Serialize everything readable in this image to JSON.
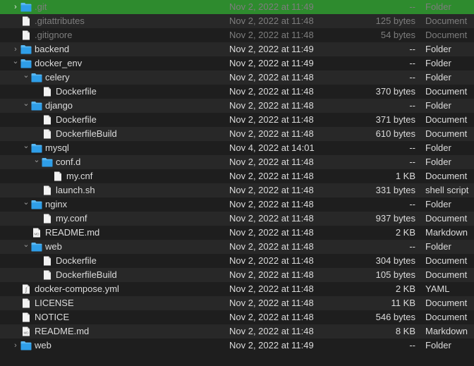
{
  "rows": [
    {
      "name": ".git",
      "date": "Nov 2, 2022 at 11:49",
      "size": "--",
      "kind": "Folder",
      "type": "folder",
      "depth": 0,
      "chevron": "right",
      "selected": true,
      "dim": true
    },
    {
      "name": ".gitattributes",
      "date": "Nov 2, 2022 at 11:48",
      "size": "125 bytes",
      "kind": "Document",
      "type": "file",
      "depth": 0,
      "chevron": "",
      "dim": true
    },
    {
      "name": ".gitignore",
      "date": "Nov 2, 2022 at 11:48",
      "size": "54 bytes",
      "kind": "Document",
      "type": "file",
      "depth": 0,
      "chevron": "",
      "dim": true
    },
    {
      "name": "backend",
      "date": "Nov 2, 2022 at 11:49",
      "size": "--",
      "kind": "Folder",
      "type": "folder",
      "depth": 0,
      "chevron": "right"
    },
    {
      "name": "docker_env",
      "date": "Nov 2, 2022 at 11:49",
      "size": "--",
      "kind": "Folder",
      "type": "folder",
      "depth": 0,
      "chevron": "down"
    },
    {
      "name": "celery",
      "date": "Nov 2, 2022 at 11:48",
      "size": "--",
      "kind": "Folder",
      "type": "folder",
      "depth": 1,
      "chevron": "down"
    },
    {
      "name": "Dockerfile",
      "date": "Nov 2, 2022 at 11:48",
      "size": "370 bytes",
      "kind": "Document",
      "type": "file",
      "depth": 2,
      "chevron": ""
    },
    {
      "name": "django",
      "date": "Nov 2, 2022 at 11:48",
      "size": "--",
      "kind": "Folder",
      "type": "folder",
      "depth": 1,
      "chevron": "down"
    },
    {
      "name": "Dockerfile",
      "date": "Nov 2, 2022 at 11:48",
      "size": "371 bytes",
      "kind": "Document",
      "type": "file",
      "depth": 2,
      "chevron": ""
    },
    {
      "name": "DockerfileBuild",
      "date": "Nov 2, 2022 at 11:48",
      "size": "610 bytes",
      "kind": "Document",
      "type": "file",
      "depth": 2,
      "chevron": ""
    },
    {
      "name": "mysql",
      "date": "Nov 4, 2022 at 14:01",
      "size": "--",
      "kind": "Folder",
      "type": "folder",
      "depth": 1,
      "chevron": "down"
    },
    {
      "name": "conf.d",
      "date": "Nov 2, 2022 at 11:48",
      "size": "--",
      "kind": "Folder",
      "type": "folder",
      "depth": 2,
      "chevron": "down"
    },
    {
      "name": "my.cnf",
      "date": "Nov 2, 2022 at 11:48",
      "size": "1 KB",
      "kind": "Document",
      "type": "file",
      "depth": 3,
      "chevron": ""
    },
    {
      "name": "launch.sh",
      "date": "Nov 2, 2022 at 11:48",
      "size": "331 bytes",
      "kind": "shell script",
      "type": "file",
      "depth": 2,
      "chevron": ""
    },
    {
      "name": "nginx",
      "date": "Nov 2, 2022 at 11:48",
      "size": "--",
      "kind": "Folder",
      "type": "folder",
      "depth": 1,
      "chevron": "down"
    },
    {
      "name": "my.conf",
      "date": "Nov 2, 2022 at 11:48",
      "size": "937 bytes",
      "kind": "Document",
      "type": "file",
      "depth": 2,
      "chevron": ""
    },
    {
      "name": "README.md",
      "date": "Nov 2, 2022 at 11:48",
      "size": "2 KB",
      "kind": "Markdown",
      "type": "md",
      "depth": 1,
      "chevron": ""
    },
    {
      "name": "web",
      "date": "Nov 2, 2022 at 11:48",
      "size": "--",
      "kind": "Folder",
      "type": "folder",
      "depth": 1,
      "chevron": "down"
    },
    {
      "name": "Dockerfile",
      "date": "Nov 2, 2022 at 11:48",
      "size": "304 bytes",
      "kind": "Document",
      "type": "file",
      "depth": 2,
      "chevron": ""
    },
    {
      "name": "DockerfileBuild",
      "date": "Nov 2, 2022 at 11:48",
      "size": "105 bytes",
      "kind": "Document",
      "type": "file",
      "depth": 2,
      "chevron": ""
    },
    {
      "name": "docker-compose.yml",
      "date": "Nov 2, 2022 at 11:48",
      "size": "2 KB",
      "kind": "YAML",
      "type": "yaml",
      "depth": 0,
      "chevron": ""
    },
    {
      "name": "LICENSE",
      "date": "Nov 2, 2022 at 11:48",
      "size": "11 KB",
      "kind": "Document",
      "type": "file",
      "depth": 0,
      "chevron": ""
    },
    {
      "name": "NOTICE",
      "date": "Nov 2, 2022 at 11:48",
      "size": "546 bytes",
      "kind": "Document",
      "type": "file",
      "depth": 0,
      "chevron": ""
    },
    {
      "name": "README.md",
      "date": "Nov 2, 2022 at 11:48",
      "size": "8 KB",
      "kind": "Markdown",
      "type": "md",
      "depth": 0,
      "chevron": ""
    },
    {
      "name": "web",
      "date": "Nov 2, 2022 at 11:49",
      "size": "--",
      "kind": "Folder",
      "type": "folder",
      "depth": 0,
      "chevron": "right"
    }
  ],
  "icons": {
    "chevron_right": "›",
    "chevron_down": "⌄",
    "md_badge": "MD",
    "yaml_badge": "ʃ"
  },
  "colors": {
    "selection": "#2e8b2e",
    "folder": "#2f9ee8",
    "folder_tab": "#58b7f2",
    "file": "#f2f2f2"
  }
}
